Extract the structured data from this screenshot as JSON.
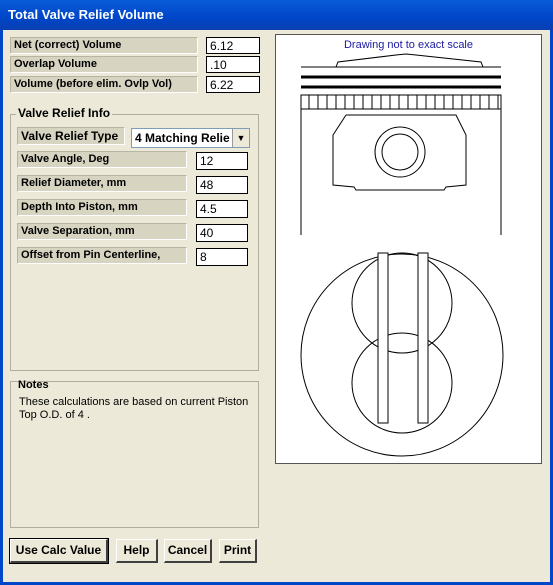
{
  "window": {
    "title": "Total Valve Relief Volume"
  },
  "volumes": [
    {
      "label": "Net (correct) Volume",
      "value": "6.12"
    },
    {
      "label": "Overlap Volume",
      "value": ".10"
    },
    {
      "label": "Volume (before elim. Ovlp Vol)",
      "value": "6.22"
    }
  ],
  "relief": {
    "title": "Valve Relief Info",
    "type_label": "Valve Relief Type",
    "type_value": "4 Matching Relie",
    "fields": [
      {
        "label": "Valve Angle, Deg",
        "value": "12"
      },
      {
        "label": "Relief Diameter, mm",
        "value": "48"
      },
      {
        "label": "Depth Into Piston, mm",
        "value": "4.5"
      },
      {
        "label": "Valve Separation, mm",
        "value": "40"
      },
      {
        "label": "Offset from Pin Centerline,",
        "value": "8"
      }
    ]
  },
  "notes": {
    "title": "Notes",
    "text": "These calculations are based on current Piston Top O.D. of  4 ."
  },
  "drawing": {
    "caption": "Drawing not to exact scale"
  },
  "buttons": {
    "use_calc": "Use Calc Value",
    "help": "Help",
    "cancel": "Cancel",
    "print": "Print"
  }
}
